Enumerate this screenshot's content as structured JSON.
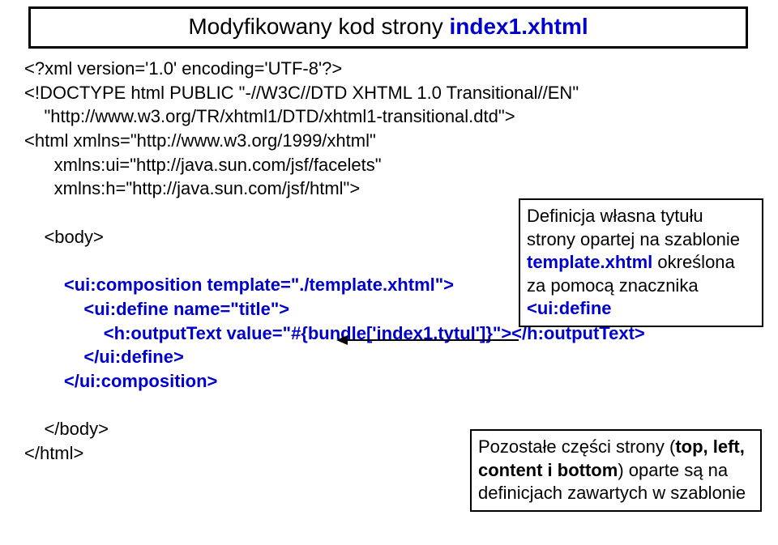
{
  "title": {
    "pre": "Modyfikowany kod strony ",
    "blue": "index1.xhtml"
  },
  "code": {
    "l1": "<?xml version='1.0' encoding='UTF-8'?>",
    "l2": "<!DOCTYPE html PUBLIC \"-//W3C//DTD XHTML 1.0 Transitional//EN\"",
    "l3": "    \"http://www.w3.org/TR/xhtml1/DTD/xhtml1-transitional.dtd\">",
    "l4": "<html xmlns=\"http://www.w3.org/1999/xhtml\"",
    "l5": "      xmlns:ui=\"http://java.sun.com/jsf/facelets\"",
    "l6": "      xmlns:h=\"http://java.sun.com/jsf/html\">",
    "l7": "    <body>",
    "l8a": "        <ui:composition template=\"./template.xhtml\">",
    "l9a": "            <ui:define name=\"title\">",
    "l10a": "                <h:outputText value=\"#{bundle['index1.tytul']}\"></h:outputText>",
    "l11a": "            </ui:define>",
    "l12a": "        </ui:composition>",
    "l13": "    </body>",
    "l14": "</html>"
  },
  "annot1": {
    "t1": "Definicja własna tytułu strony opartej na szablonie ",
    "b1": "template.xhtml",
    "t2": " określona za pomocą znacznika ",
    "b2": "<ui:define"
  },
  "annot2": {
    "t1": "Pozostałe części strony (",
    "b1": "top, left, content i bottom",
    "t2": ") oparte są na definicjach zawartych w szablonie"
  }
}
